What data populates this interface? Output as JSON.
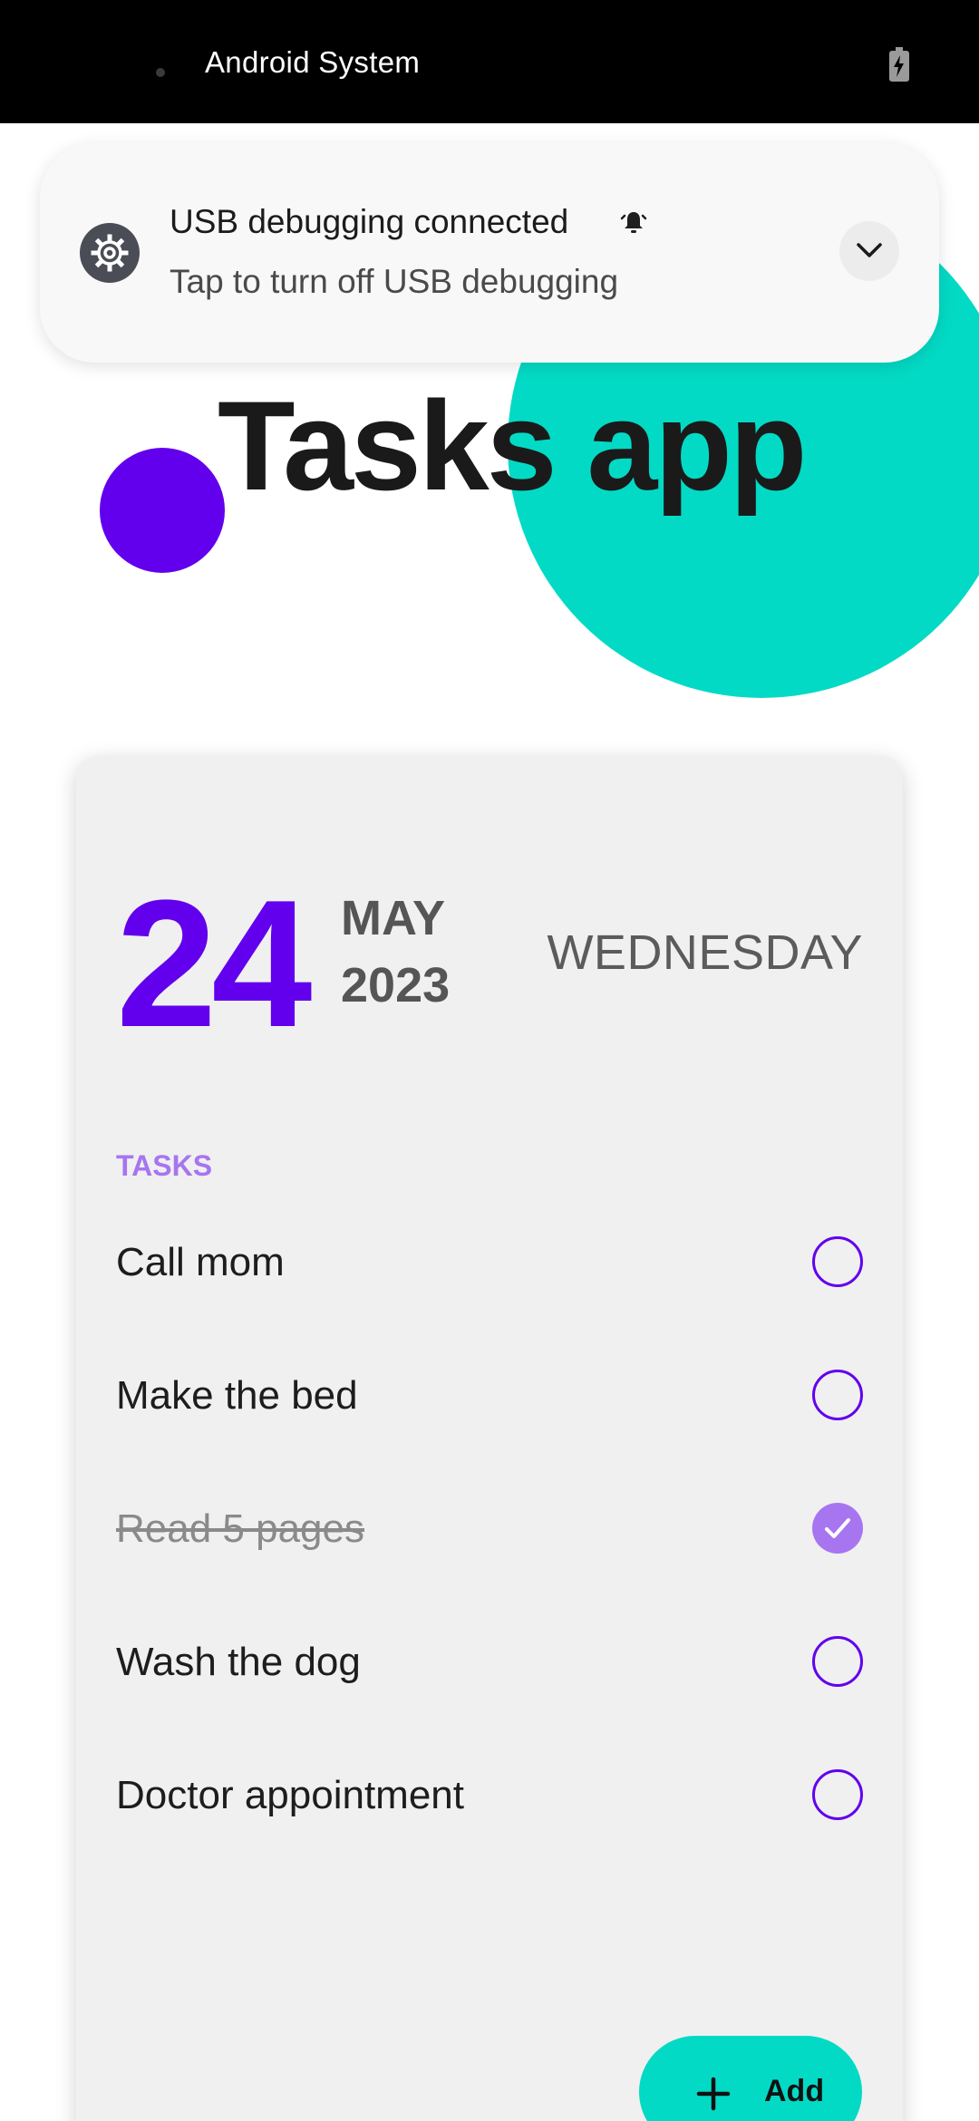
{
  "status_bar": {
    "title": "Android System",
    "battery_icon": "battery-charging-icon"
  },
  "notification": {
    "icon": "gear-icon",
    "title": "USB debugging connected",
    "alert_icon": "bell-icon",
    "text": "Tap to turn off USB debugging",
    "expand_icon": "chevron-down-icon"
  },
  "app": {
    "title": "Tasks app"
  },
  "date": {
    "day": "24",
    "month": "MAY",
    "year": "2023",
    "weekday": "WEDNESDAY"
  },
  "tasks": {
    "heading": "TASKS",
    "items": [
      {
        "label": "Call mom",
        "done": false
      },
      {
        "label": "Make the bed",
        "done": false
      },
      {
        "label": "Read 5 pages",
        "done": true
      },
      {
        "label": "Wash the dog",
        "done": false
      },
      {
        "label": "Doctor appointment",
        "done": false
      }
    ]
  },
  "add_button": {
    "label": "Add",
    "icon": "plus-icon"
  },
  "colors": {
    "primary": "#6200EE",
    "accent": "#03DAC5",
    "done": "#A775F0"
  }
}
